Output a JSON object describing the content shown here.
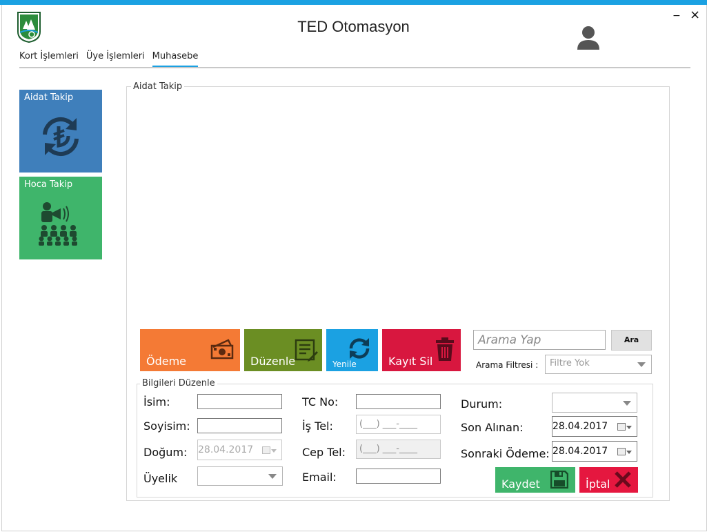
{
  "app": {
    "title": "TED Otomasyon"
  },
  "window_controls": {
    "minimize": "−",
    "close": "×"
  },
  "menu": {
    "items": [
      "Kort İşlemleri",
      "Üye İşlemleri",
      "Muhasebe"
    ],
    "active_index": 2
  },
  "tiles": [
    {
      "label": "Aidat Takip",
      "color": "#3f7fbb",
      "icon": "lira-refresh-icon"
    },
    {
      "label": "Hoca Takip",
      "color": "#3fb56b",
      "icon": "teacher-audience-icon"
    }
  ],
  "main_group": {
    "title": "Aidat Takip"
  },
  "actions": {
    "odeme": "Ödeme",
    "duzenle": "Düzenle",
    "yenile": "Yenile",
    "kayit_sil": "Kayıt Sil"
  },
  "search": {
    "placeholder": "Arama Yap",
    "button": "Ara",
    "filter_label": "Arama Filtresi :",
    "filter_value": "Filtre Yok"
  },
  "edit_group": {
    "title": "Bilgileri Düzenle",
    "isim": "İsim:",
    "soyisim": "Soyisim:",
    "dogum": "Doğum:",
    "dogum_value": "28.04.2017",
    "uyelik": "Üyelik",
    "tc": "TC No:",
    "is_tel": "İş Tel:",
    "cep_tel": "Cep Tel:",
    "email": "Email:",
    "phone_mask": "(___) ___-____",
    "durum": "Durum:",
    "son_alinan": "Son Alınan:",
    "son_alinan_value": "28.04.2017",
    "sonraki_odeme": "Sonraki Ödeme:",
    "sonraki_odeme_value": "28.04.2017",
    "kaydet": "Kaydet",
    "iptal": "İptal"
  },
  "colors": {
    "accent": "#1ba1e2",
    "orange": "#f47a35",
    "olive": "#6b8e23",
    "cyan": "#1ba1e2",
    "crimson": "#d8173f",
    "green": "#3fb56b",
    "red": "#e5173f",
    "blue_tile": "#3f7fbb"
  }
}
